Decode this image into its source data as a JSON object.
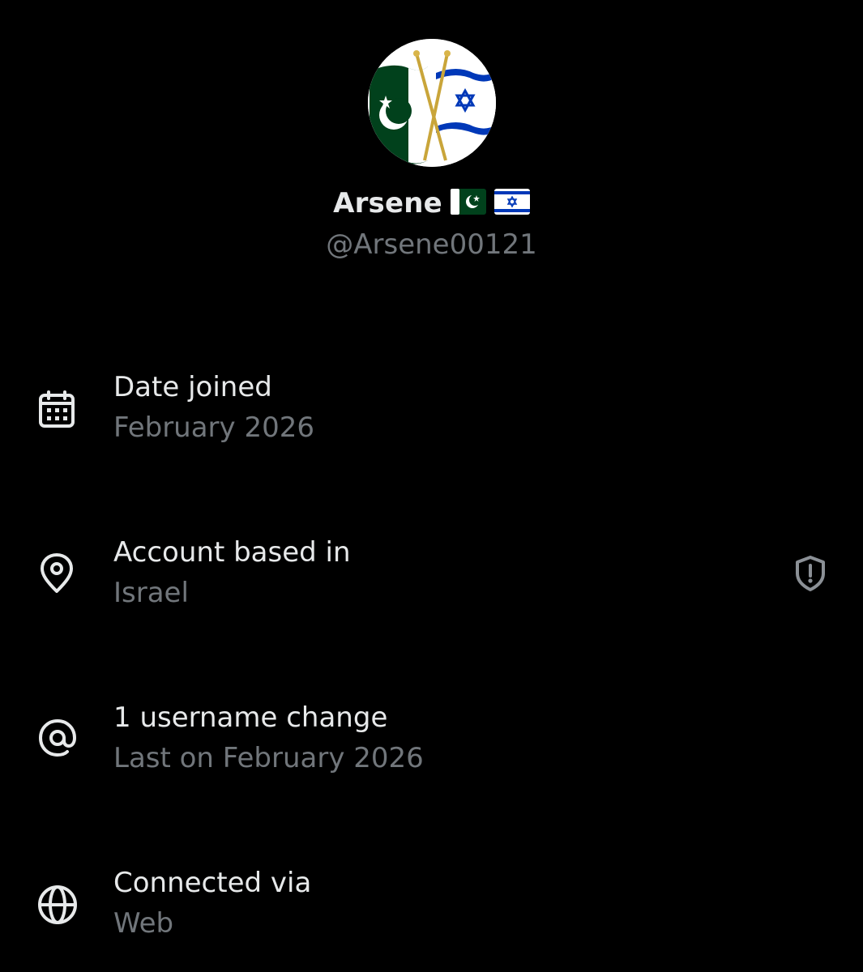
{
  "profile": {
    "display_name": "Arsene",
    "name_flags": [
      "pakistan-flag",
      "israel-flag"
    ],
    "handle": "@Arsene00121",
    "avatar": "pakistan-israel-crossed-flags"
  },
  "details": [
    {
      "icon": "calendar-icon",
      "title": "Date joined",
      "value": "February 2026"
    },
    {
      "icon": "location-pin-icon",
      "title": "Account based in",
      "value": "Israel",
      "trailing_icon": "shield-alert-icon"
    },
    {
      "icon": "at-sign-icon",
      "title": "1 username change",
      "value": "Last on February 2026"
    },
    {
      "icon": "globe-icon",
      "title": "Connected via",
      "value": "Web"
    }
  ],
  "colors": {
    "background": "#000000",
    "primary_text": "#e7e9ea",
    "secondary_text": "#71767b",
    "pakistan_green": "#01411c",
    "israel_blue": "#0038b8"
  }
}
